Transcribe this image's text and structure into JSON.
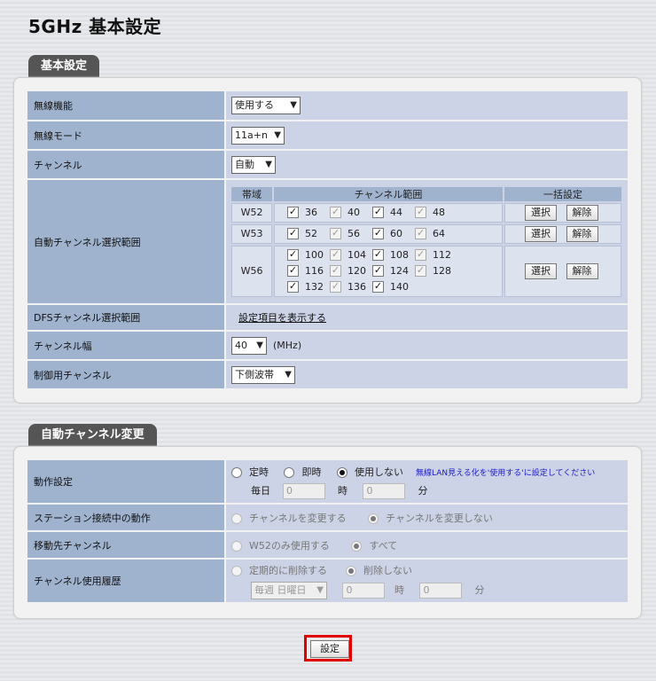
{
  "page_title": "5GHz 基本設定",
  "basic": {
    "tab": "基本設定",
    "rows": {
      "wireless": {
        "label": "無線機能",
        "value": "使用する"
      },
      "mode": {
        "label": "無線モード",
        "value": "11a+n"
      },
      "channel": {
        "label": "チャンネル",
        "value": "自動"
      },
      "auto_range": {
        "label": "自動チャンネル選択範囲"
      },
      "dfs": {
        "label": "DFSチャンネル選択範囲",
        "link": "設定項目を表示する"
      },
      "width": {
        "label": "チャンネル幅",
        "value": "40",
        "unit": "(MHz)"
      },
      "ctrl": {
        "label": "制御用チャンネル",
        "value": "下側波帯"
      }
    },
    "channel_table": {
      "headers": {
        "band": "帯域",
        "range": "チャンネル範囲",
        "bulk": "一括設定"
      },
      "select_label": "選択",
      "clear_label": "解除",
      "bands": {
        "w52": {
          "name": "W52",
          "channels": [
            "36",
            "40",
            "44",
            "48"
          ]
        },
        "w53": {
          "name": "W53",
          "channels": [
            "52",
            "56",
            "60",
            "64"
          ]
        },
        "w56": {
          "name": "W56",
          "channels": [
            "100",
            "104",
            "108",
            "112",
            "116",
            "120",
            "124",
            "128",
            "132",
            "136",
            "140"
          ]
        }
      }
    }
  },
  "auto": {
    "tab": "自動チャンネル変更",
    "rows": {
      "operation": {
        "label": "動作設定",
        "opt1": "定時",
        "opt2": "即時",
        "opt3": "使用しない",
        "note": "無線LAN見える化を'使用する'に設定してください",
        "daily": "毎日",
        "hour_val": "0",
        "hour_unit": "時",
        "min_val": "0",
        "min_unit": "分"
      },
      "station": {
        "label": "ステーション接続中の動作",
        "opt1": "チャンネルを変更する",
        "opt2": "チャンネルを変更しない"
      },
      "dest": {
        "label": "移動先チャンネル",
        "opt1": "W52のみ使用する",
        "opt2": "すべて"
      },
      "history": {
        "label": "チャンネル使用履歴",
        "opt1": "定期的に削除する",
        "opt2": "削除しない",
        "week": "毎週 日曜日",
        "hour_val": "0",
        "hour_unit": "時",
        "min_val": "0",
        "min_unit": "分"
      }
    }
  },
  "submit_label": "設定",
  "colors": {
    "label_bg": "#9fb3cf",
    "value_bg": "#ccd3e6",
    "highlight": "#e00000",
    "tab_bg": "#555555"
  }
}
